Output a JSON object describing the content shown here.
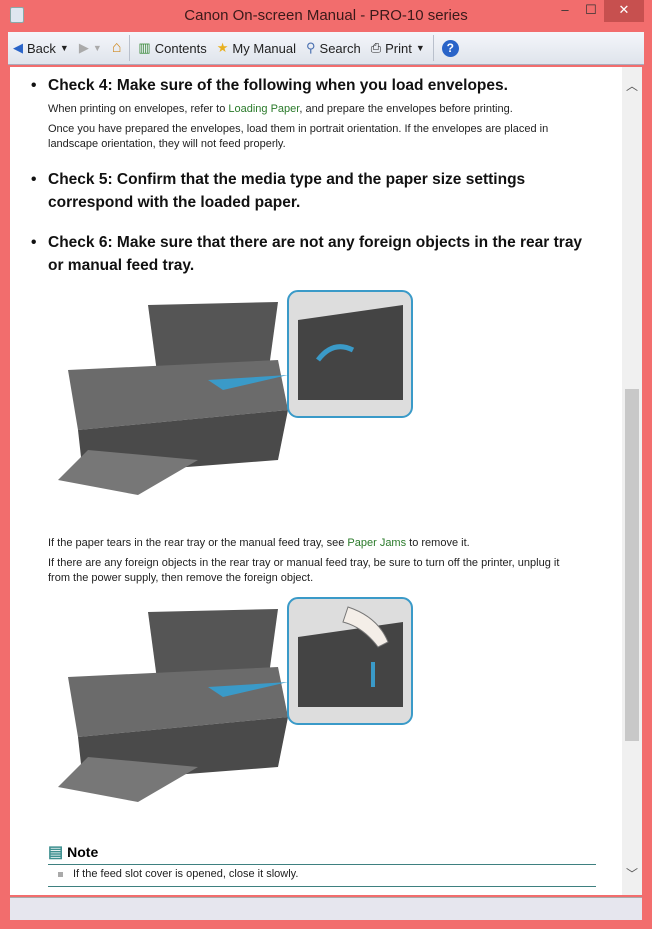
{
  "window": {
    "title": "Canon On-screen Manual - PRO-10 series",
    "minimize": "–",
    "maximize": "☐",
    "close": "✕"
  },
  "toolbar": {
    "back": "Back",
    "contents": "Contents",
    "my_manual": "My Manual",
    "search": "Search",
    "print": "Print"
  },
  "content": {
    "check4": "Check 4: Make sure of the following when you load envelopes.",
    "check4_p1_pre": "When printing on envelopes, refer to ",
    "check4_p1_link": "Loading Paper",
    "check4_p1_post": ", and prepare the envelopes before printing.",
    "check4_p2": "Once you have prepared the envelopes, load them in portrait orientation. If the envelopes are placed in landscape orientation, they will not feed properly.",
    "check5": "Check 5: Confirm that the media type and the paper size settings correspond with the loaded paper.",
    "check6": "Check 6: Make sure that there are not any foreign objects in the rear tray or manual feed tray.",
    "p3_pre": "If the paper tears in the rear tray or the manual feed tray, see ",
    "p3_link": "Paper Jams",
    "p3_post": " to remove it.",
    "p4": "If there are any foreign objects in the rear tray or manual feed tray, be sure to turn off the printer, unplug it from the power supply, then remove the foreign object.",
    "note_title": "Note",
    "note_item": "If the feed slot cover is opened, close it slowly."
  },
  "scrollbar": {
    "position_fraction": 0.42
  },
  "colors": {
    "frame": "#f26d6d",
    "link": "#2a7a2a",
    "note_rule": "#3e8080"
  }
}
